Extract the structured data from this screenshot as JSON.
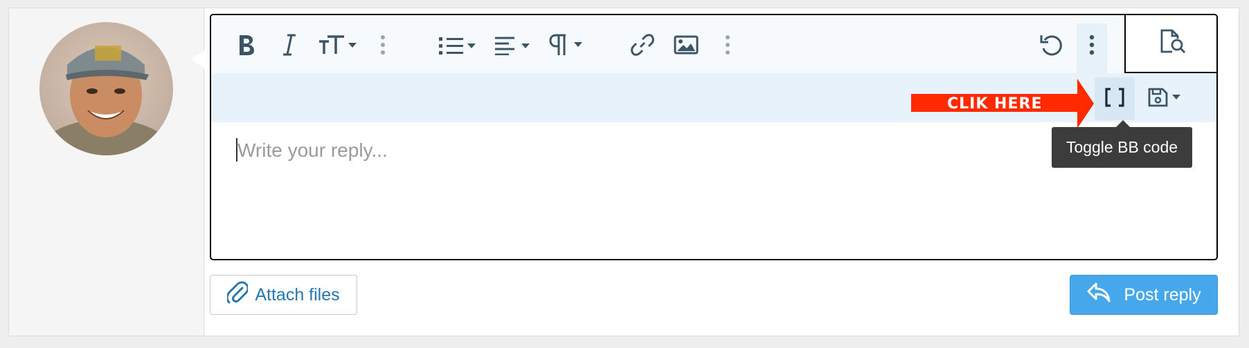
{
  "editor": {
    "placeholder": "Write your reply..."
  },
  "toolbar": {
    "tooltip": "Toggle BB code"
  },
  "annotation": {
    "label": "CLIK HERE",
    "color": "#ff2a00"
  },
  "actions": {
    "attach_label": "Attach files",
    "post_label": "Post reply"
  },
  "icons": {
    "bold": "bold-icon",
    "italic": "italic-icon",
    "font_size": "font-size-icon",
    "more": "vertical-dots-icon",
    "list": "list-icon",
    "align": "align-left-icon",
    "paragraph": "paragraph-icon",
    "link": "link-icon",
    "image": "image-icon",
    "undo": "undo-icon",
    "preview": "document-search-icon",
    "bbcode": "brackets-icon",
    "drafts": "floppy-disk-icon",
    "attach": "paperclip-icon",
    "post": "reply-arrow-icon"
  },
  "colors": {
    "accent": "#47a7eb",
    "link": "#2577b1",
    "icon": "#3b5566"
  }
}
